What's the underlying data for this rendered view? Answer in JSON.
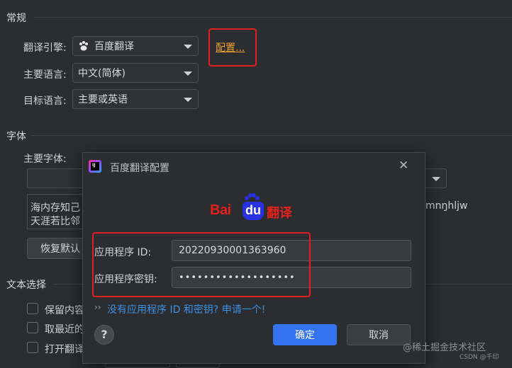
{
  "general": {
    "section_title": "常规",
    "engine_label": "翻译引擎:",
    "engine_value": "百度翻译",
    "configure_link": "配置...",
    "primary_lang_label": "主要语言:",
    "primary_lang_value": "中文(简体)",
    "target_lang_label": "目标语言:",
    "target_lang_value": "主要或英语"
  },
  "font": {
    "section_title": "字体",
    "primary_font_label": "主要字体:",
    "preview_line1": "海内存知己",
    "preview_line2": "天涯若比邻",
    "preview_right": "mnŋhljw",
    "restore_button": "恢复默认"
  },
  "text_selection": {
    "section_title": "文本选择",
    "options": [
      "保留内容",
      "取最近的",
      "打开翻译"
    ]
  },
  "dialog": {
    "title": "百度翻译配置",
    "logo_text_bai": "Bai",
    "logo_text_du": "du",
    "logo_text_cn": "翻译",
    "app_id_label": "应用程序 ID:",
    "app_id_value": "20220930001363960",
    "app_key_label": "应用程序密钥:",
    "app_key_value": "•••••••••••••••••••",
    "apply_link_prefix": "››",
    "apply_link": "没有应用程序 ID 和密钥? 申请一个!",
    "help_label": "?",
    "ok_button": "确定",
    "cancel_button": "取消",
    "close_symbol": "✕"
  },
  "watermark": {
    "main": "@稀土掘金技术社区",
    "small": "CSDN @千印"
  },
  "colors": {
    "background": "#2b2d30",
    "link_orange": "#f0a030",
    "link_blue": "#3d8fe0",
    "highlight_red": "#e21f1f",
    "primary_button": "#3574f0"
  }
}
